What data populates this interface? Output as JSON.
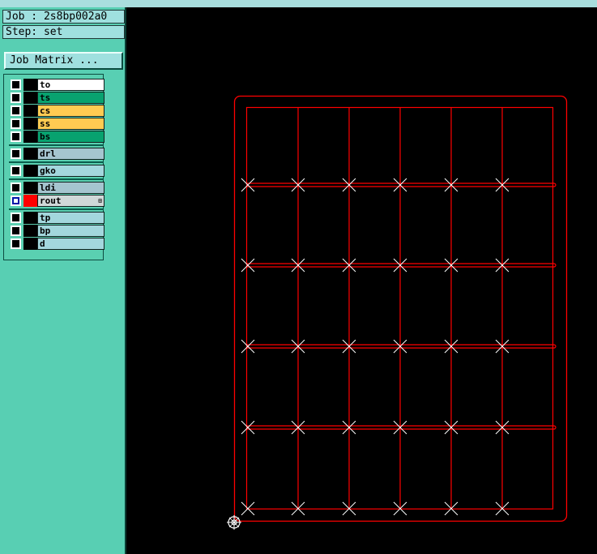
{
  "header": {
    "job_label": "Job : 2s8bp002a0",
    "step_label": "Step: set"
  },
  "job_matrix_button": "Job Matrix ...",
  "layers": [
    {
      "name": "to",
      "bg": "#ffffff",
      "checked": false,
      "swatch": "black"
    },
    {
      "name": "ts",
      "bg": "#08a26f",
      "checked": false,
      "swatch": "black"
    },
    {
      "name": "cs",
      "bg": "#ffcb52",
      "checked": false,
      "swatch": "black"
    },
    {
      "name": "ss",
      "bg": "#ffcb52",
      "checked": false,
      "swatch": "black"
    },
    {
      "name": "bs",
      "bg": "#08a26f",
      "checked": false,
      "swatch": "black"
    },
    {
      "name": "drl",
      "bg": "#a5c5cf",
      "checked": false,
      "swatch": "black"
    },
    {
      "name": "gko",
      "bg": "#a3d7dd",
      "checked": false,
      "swatch": "black"
    },
    {
      "name": "ldi",
      "bg": "#a5c5cf",
      "checked": false,
      "swatch": "black"
    },
    {
      "name": "rout",
      "bg": "#d0d8d8",
      "checked": true,
      "swatch": "red",
      "marker": "⊞"
    },
    {
      "name": "tp",
      "bg": "#a3d7dd",
      "checked": false,
      "swatch": "black"
    },
    {
      "name": "bp",
      "bg": "#a3d7dd",
      "checked": false,
      "swatch": "black"
    },
    {
      "name": "d",
      "bg": "#a3d7dd",
      "checked": false,
      "swatch": "black"
    }
  ],
  "colors": {
    "rout": "#ff0000",
    "marker": "#ffffff",
    "canvas": "#000000"
  },
  "icons": [
    "checkbox-icon",
    "origin-crosshair-icon",
    "x-marker-icon"
  ]
}
